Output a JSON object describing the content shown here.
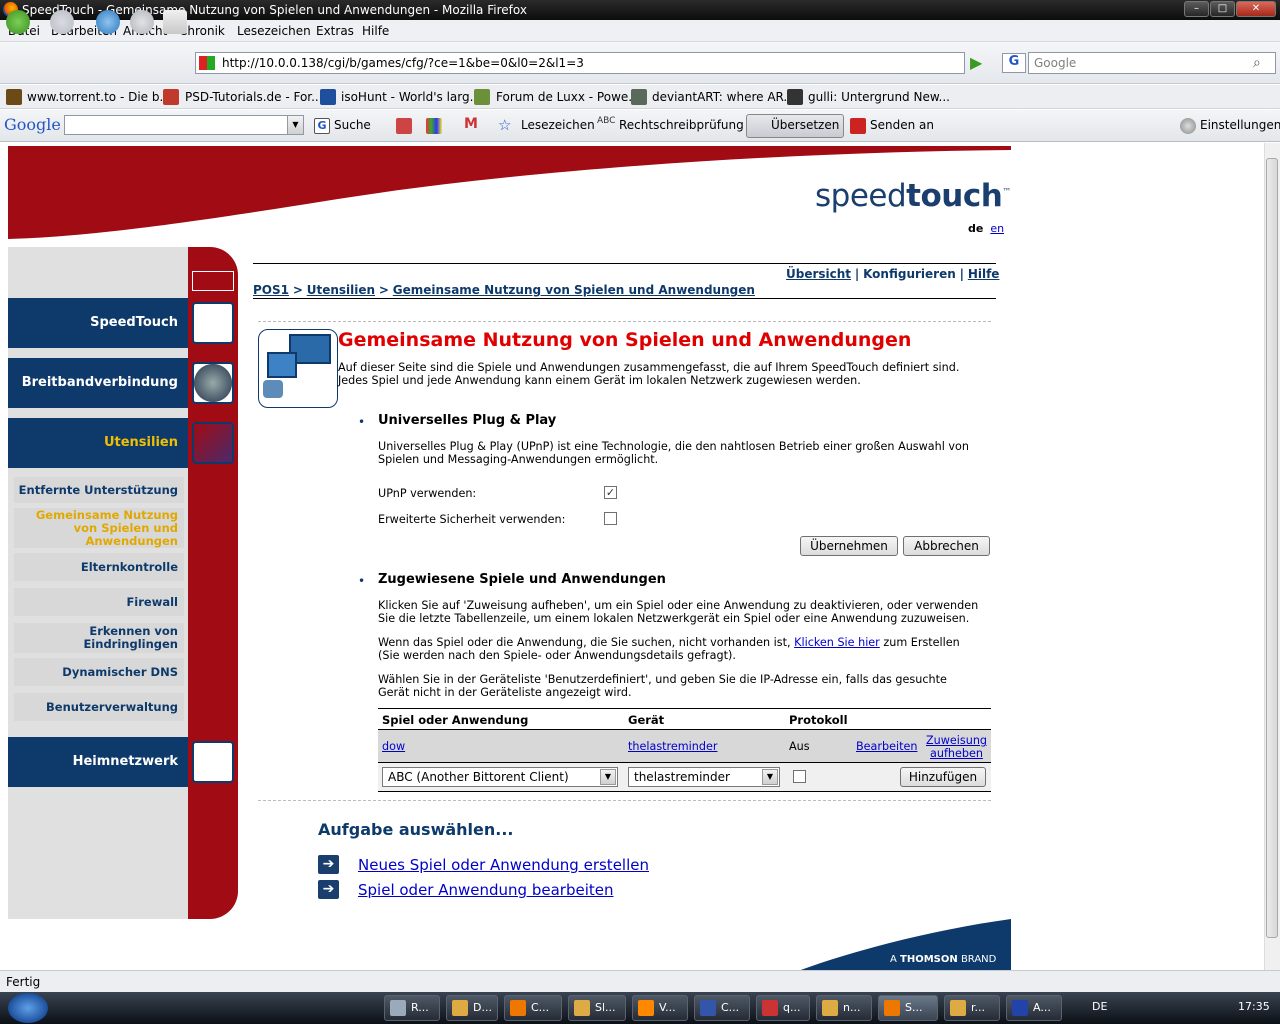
{
  "window": {
    "title": "SpeedTouch - Gemeinsame Nutzung von Spielen und Anwendungen - Mozilla Firefox",
    "controls": [
      "–",
      "□",
      "✕"
    ]
  },
  "menu": [
    "Datei",
    "Bearbeiten",
    "Ansicht",
    "Chronik",
    "Lesezeichen",
    "Extras",
    "Hilfe"
  ],
  "nav": {
    "url": "http://10.0.0.138/cgi/b/games/cfg/?ce=1&be=0&l0=2&l1=3",
    "search_placeholder": "Google"
  },
  "bookmarks": [
    "www.torrent.to - Die b...",
    "PSD-Tutorials.de - For...",
    "isoHunt - World's larg...",
    "Forum de Luxx - Powe...",
    "deviantART: where AR...",
    "gulli: Untergrund New..."
  ],
  "googlebar": {
    "logo": "Google",
    "search": "Suche",
    "bookmarks": "Lesezeichen",
    "spell": "Rechtschreibprüfung",
    "translate": "Übersetzen",
    "send": "Senden an",
    "settings": "Einstellungen"
  },
  "page": {
    "logo_a": "speed",
    "logo_b": "touch",
    "logo_tm": "™",
    "lang_de": "de",
    "lang_en": "en",
    "top_links": {
      "overview": "Übersicht",
      "configure": "Konfigurieren",
      "help": "Hilfe",
      "sep": "|"
    },
    "breadcrumb": {
      "home": "POS1",
      "tools": "Utensilien",
      "current": "Gemeinsame Nutzung von Spielen und Anwendungen",
      "sep": ">"
    },
    "sidebar": {
      "speedtouch": "SpeedTouch",
      "broadband": "Breitbandverbindung",
      "tools": "Utensilien",
      "sub": [
        "Entfernte Unterstützung",
        "Gemeinsame Nutzung von Spielen und Anwendungen",
        "Elternkontrolle",
        "Firewall",
        "Erkennen von Eindringlingen",
        "Dynamischer DNS",
        "Benutzerverwaltung"
      ],
      "home": "Heimnetzwerk"
    },
    "title": "Gemeinsame Nutzung von Spielen und Anwendungen",
    "intro1": "Auf dieser Seite sind die Spiele und Anwendungen zusammengefasst, die auf Ihrem SpeedTouch definiert sind.",
    "intro2": "Jedes Spiel und jede Anwendung kann einem Gerät im lokalen Netzwerk zugewiesen werden.",
    "upnp": {
      "heading": "Universelles Plug & Play",
      "desc1": "Universelles Plug & Play (UPnP) ist eine Technologie, die den nahtlosen Betrieb einer großen Auswahl von",
      "desc2": "Spielen und Messaging-Anwendungen ermöglicht.",
      "use_label": "UPnP verwenden:",
      "use_checked": true,
      "sec_label": "Erweiterte Sicherheit verwenden:",
      "sec_checked": false,
      "apply": "Übernehmen",
      "cancel": "Abbrechen"
    },
    "assigned": {
      "heading": "Zugewiesene Spiele und Anwendungen",
      "p1a": "Klicken Sie auf 'Zuweisung aufheben', um ein Spiel oder eine Anwendung zu deaktivieren, oder verwenden",
      "p1b": "Sie die letzte Tabellenzeile, um einem lokalen Netzwerkgerät ein Spiel oder eine Anwendung zuzuweisen.",
      "p2a": "Wenn das Spiel oder die Anwendung, die Sie suchen, nicht vorhanden ist,",
      "p2link": "Klicken Sie hier",
      "p2b": "zum Erstellen",
      "p2c": "(Sie werden nach den Spiele- oder Anwendungsdetails gefragt).",
      "p3a": "Wählen Sie in der Geräteliste 'Benutzerdefiniert', und geben Sie die IP-Adresse ein, falls das gesuchte",
      "p3b": "Gerät nicht in der Geräteliste angezeigt wird.",
      "columns": [
        "Spiel oder Anwendung",
        "Gerät",
        "Protokoll"
      ],
      "row": {
        "game": "dow",
        "device": "thelastreminder",
        "protocol": "Aus",
        "edit": "Bearbeiten",
        "unassign1": "Zuweisung",
        "unassign2": "aufheben"
      },
      "new_row": {
        "game": "ABC (Another Bittorent Client)",
        "device": "thelastreminder",
        "add": "Hinzufügen"
      }
    },
    "tasks": {
      "heading": "Aufgabe auswählen...",
      "items": [
        "Neues Spiel oder Anwendung erstellen",
        "Spiel oder Anwendung bearbeiten"
      ]
    },
    "footer_a": "A",
    "footer_brand": "THOMSON",
    "footer_b": "BRAND"
  },
  "status": "Fertig",
  "taskbar": {
    "items": [
      "R...",
      "D...",
      "C...",
      "Sl...",
      "V...",
      "C...",
      "q...",
      "n...",
      "S...",
      "r...",
      "A..."
    ],
    "lang": "DE",
    "clock": "17:35"
  },
  "colors": {
    "brand_blue": "#0e3a6b",
    "brand_red": "#a00b14",
    "title_red": "#e00000",
    "tools_yellow": "#f0c000"
  }
}
